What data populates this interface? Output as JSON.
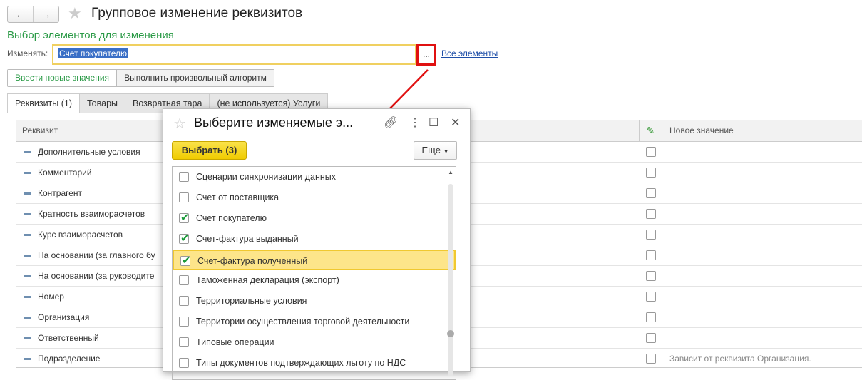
{
  "header": {
    "back": "←",
    "forward": "→",
    "title": "Групповое изменение реквизитов"
  },
  "section_title": "Выбор элементов для изменения",
  "change_label": "Изменять:",
  "change_value": "Счет покупателю",
  "select_button": "...",
  "all_elements_link": "Все элементы",
  "mode_buttons": [
    "Ввести новые значения",
    "Выполнить произвольный алгоритм"
  ],
  "tabs": [
    "Реквизиты (1)",
    "Товары",
    "Возвратная тара",
    "(не используется) Услуги"
  ],
  "table": {
    "col_name": "Реквизит",
    "col_new_value": "Новое значение",
    "rows": [
      {
        "name": "Дополнительные условия",
        "value": ""
      },
      {
        "name": "Комментарий",
        "value": ""
      },
      {
        "name": "Контрагент",
        "value": ""
      },
      {
        "name": "Кратность взаиморасчетов",
        "value": ""
      },
      {
        "name": "Курс взаиморасчетов",
        "value": ""
      },
      {
        "name": "На основании (за главного бу",
        "value": ""
      },
      {
        "name": "На основании (за руководите",
        "value": ""
      },
      {
        "name": "Номер",
        "value": ""
      },
      {
        "name": "Организация",
        "value": ""
      },
      {
        "name": "Ответственный",
        "value": ""
      },
      {
        "name": "Подразделение",
        "value": "Зависит от реквизита Организация."
      }
    ]
  },
  "dialog": {
    "title": "Выберите изменяемые э...",
    "select_button": "Выбрать (3)",
    "more_button": "Еще",
    "items": [
      {
        "label": "Сценарии синхронизации данных",
        "checked": false
      },
      {
        "label": "Счет от поставщика",
        "checked": false
      },
      {
        "label": "Счет покупателю",
        "checked": true
      },
      {
        "label": "Счет-фактура выданный",
        "checked": true
      },
      {
        "label": "Счет-фактура полученный",
        "checked": true,
        "selected": true
      },
      {
        "label": "Таможенная декларация (экспорт)",
        "checked": false
      },
      {
        "label": "Территориальные условия",
        "checked": false
      },
      {
        "label": "Территории осуществления торговой деятельности",
        "checked": false
      },
      {
        "label": "Типовые операции",
        "checked": false
      },
      {
        "label": "Типы документов подтверждающих льготу по НДС",
        "checked": false
      }
    ]
  },
  "colors": {
    "accent_green": "#2a9a46",
    "highlight": "#fde58a",
    "annotation_red": "#e01010"
  }
}
